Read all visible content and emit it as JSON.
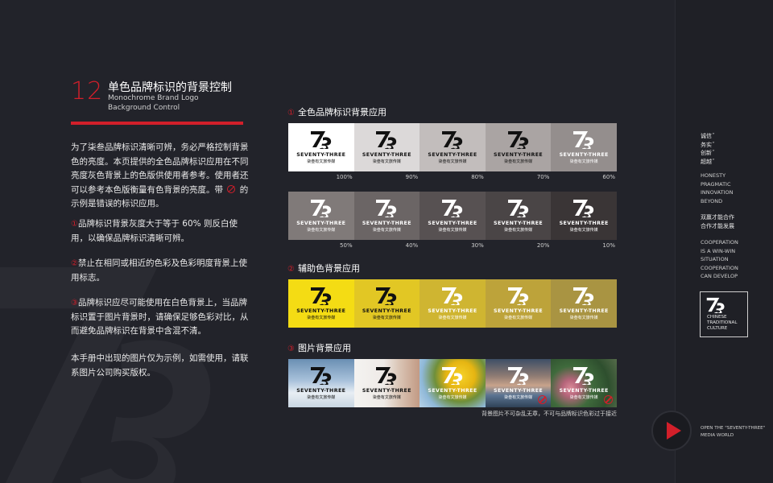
{
  "colors": {
    "accent": "#d21f2a",
    "background": "#22232a"
  },
  "header": {
    "number": "12",
    "title_cn": "单色品牌标识的背景控制",
    "title_en_1": "Monochrome Brand Logo",
    "title_en_2": "Background Control"
  },
  "body": {
    "intro_1": "为了柒叁品牌标识清晰可辨，务必严格控制背景色的亮度。本页提供的全色品牌标识应用在不同亮度灰色背景上的色版供使用者参考。使用者还可以参考本色版衡量有色背景的亮度。带",
    "intro_2": "的示例是错误的标识应用。",
    "rule1_num": "①",
    "rule1": "品牌标识背景灰度大于等于 60% 则反白使用，以确保品牌标识清晰可辨。",
    "rule2_num": "②",
    "rule2": "禁止在相同或相近的色彩及色彩明度背景上使用标志。",
    "rule3_num": "③",
    "rule3": "品牌标识应尽可能使用在白色背景上，当品牌标识置于图片背景时，请确保足够色彩对比，从而避免品牌标识在背景中含混不清。",
    "note": "本手册中出现的图片仅为示例，如需使用，请联系图片公司购买版权。"
  },
  "brand": {
    "name": "SEVENTY-THREE",
    "sub": "柒叁有文旅传媒",
    "mark_icon": "seventy-three-logo-icon"
  },
  "sections": [
    {
      "num": "①",
      "title": "全色品牌标识背景应用"
    },
    {
      "num": "②",
      "title": "辅助色背景应用"
    },
    {
      "num": "③",
      "title": "图片背景应用"
    }
  ],
  "gray_row_1": [
    {
      "bg": "#ffffff",
      "fg": "#111111",
      "pct": "100%"
    },
    {
      "bg": "#dcd9d9",
      "fg": "#111111",
      "pct": "90%"
    },
    {
      "bg": "#c2bdbc",
      "fg": "#111111",
      "pct": "80%"
    },
    {
      "bg": "#aaa4a3",
      "fg": "#111111",
      "pct": "70%"
    },
    {
      "bg": "#948e8d",
      "fg": "#ffffff",
      "pct": "60%"
    }
  ],
  "gray_row_2": [
    {
      "bg": "#807a79",
      "fg": "#ffffff",
      "pct": "50%"
    },
    {
      "bg": "#6b6565",
      "fg": "#ffffff",
      "pct": "40%"
    },
    {
      "bg": "#575152",
      "fg": "#ffffff",
      "pct": "30%"
    },
    {
      "bg": "#4a4546",
      "fg": "#ffffff",
      "pct": "20%"
    },
    {
      "bg": "#3a3536",
      "fg": "#ffffff",
      "pct": "10%"
    }
  ],
  "yellow_row": [
    {
      "bg": "#f4dc14",
      "fg": "#111111"
    },
    {
      "bg": "#e2c724",
      "fg": "#111111"
    },
    {
      "bg": "#cfb531",
      "fg": "#ffffff"
    },
    {
      "bg": "#bda33a",
      "fg": "#ffffff"
    },
    {
      "bg": "#a99442",
      "fg": "#ffffff"
    }
  ],
  "photo_row": [
    {
      "bg": "linear-gradient(180deg,#6a8fb3 0%,#a9c2db 45%,#e8eef4 70%,#c9d6e2 100%)",
      "fg": "#111111",
      "forbid": false
    },
    {
      "bg": "linear-gradient(90deg,#f4f3f1 0%,#eeeae6 45%,#d9c3b3 70%,#c29a84 100%)",
      "fg": "#111111",
      "forbid": false
    },
    {
      "bg": "radial-gradient(circle at 62% 35%,#f6d229 0%,#e6b512 28%,#6f8f3a 50%,#8fb8d8 75%,#b8d3e8 100%)",
      "fg": "#ffffff",
      "forbid": false
    },
    {
      "bg": "linear-gradient(180deg,#3e4f66 0%,#8e7b73 35%,#c8a38b 55%,#5b7492 75%,#2f4257 100%)",
      "fg": "#ffffff",
      "forbid": true
    },
    {
      "bg": "radial-gradient(circle at 30% 60%,#d98a98 0%,#b6657b 15%,#3f6a3c 40%,#2e4f2e 70%,#556b4a 100%)",
      "fg": "#ffffff",
      "forbid": true
    }
  ],
  "caption": "背景图片不可杂乱无章，不可与品牌标识色彩过于接近",
  "sidebar": {
    "values_cn": [
      "诚信˝",
      "务实˝",
      "创新˝",
      "超越˝"
    ],
    "values_en": [
      "HONESTY",
      "PRAGMATIC",
      "INNOVATION",
      "BEYOND"
    ],
    "motto_cn": [
      "双赢才能合作",
      "合作才能发展"
    ],
    "motto_en": [
      "COOPERATION",
      "IS A WIN-WIN",
      "SITUATION",
      "COOPERATION",
      "CAN DEVELOP"
    ],
    "logo_text": [
      "CHINESE",
      "TRADITIONAL",
      "CULTURE"
    ],
    "footer": [
      "OPEN THE \"SEVENTY-THREE\"",
      "MEDIA WORLD"
    ]
  }
}
